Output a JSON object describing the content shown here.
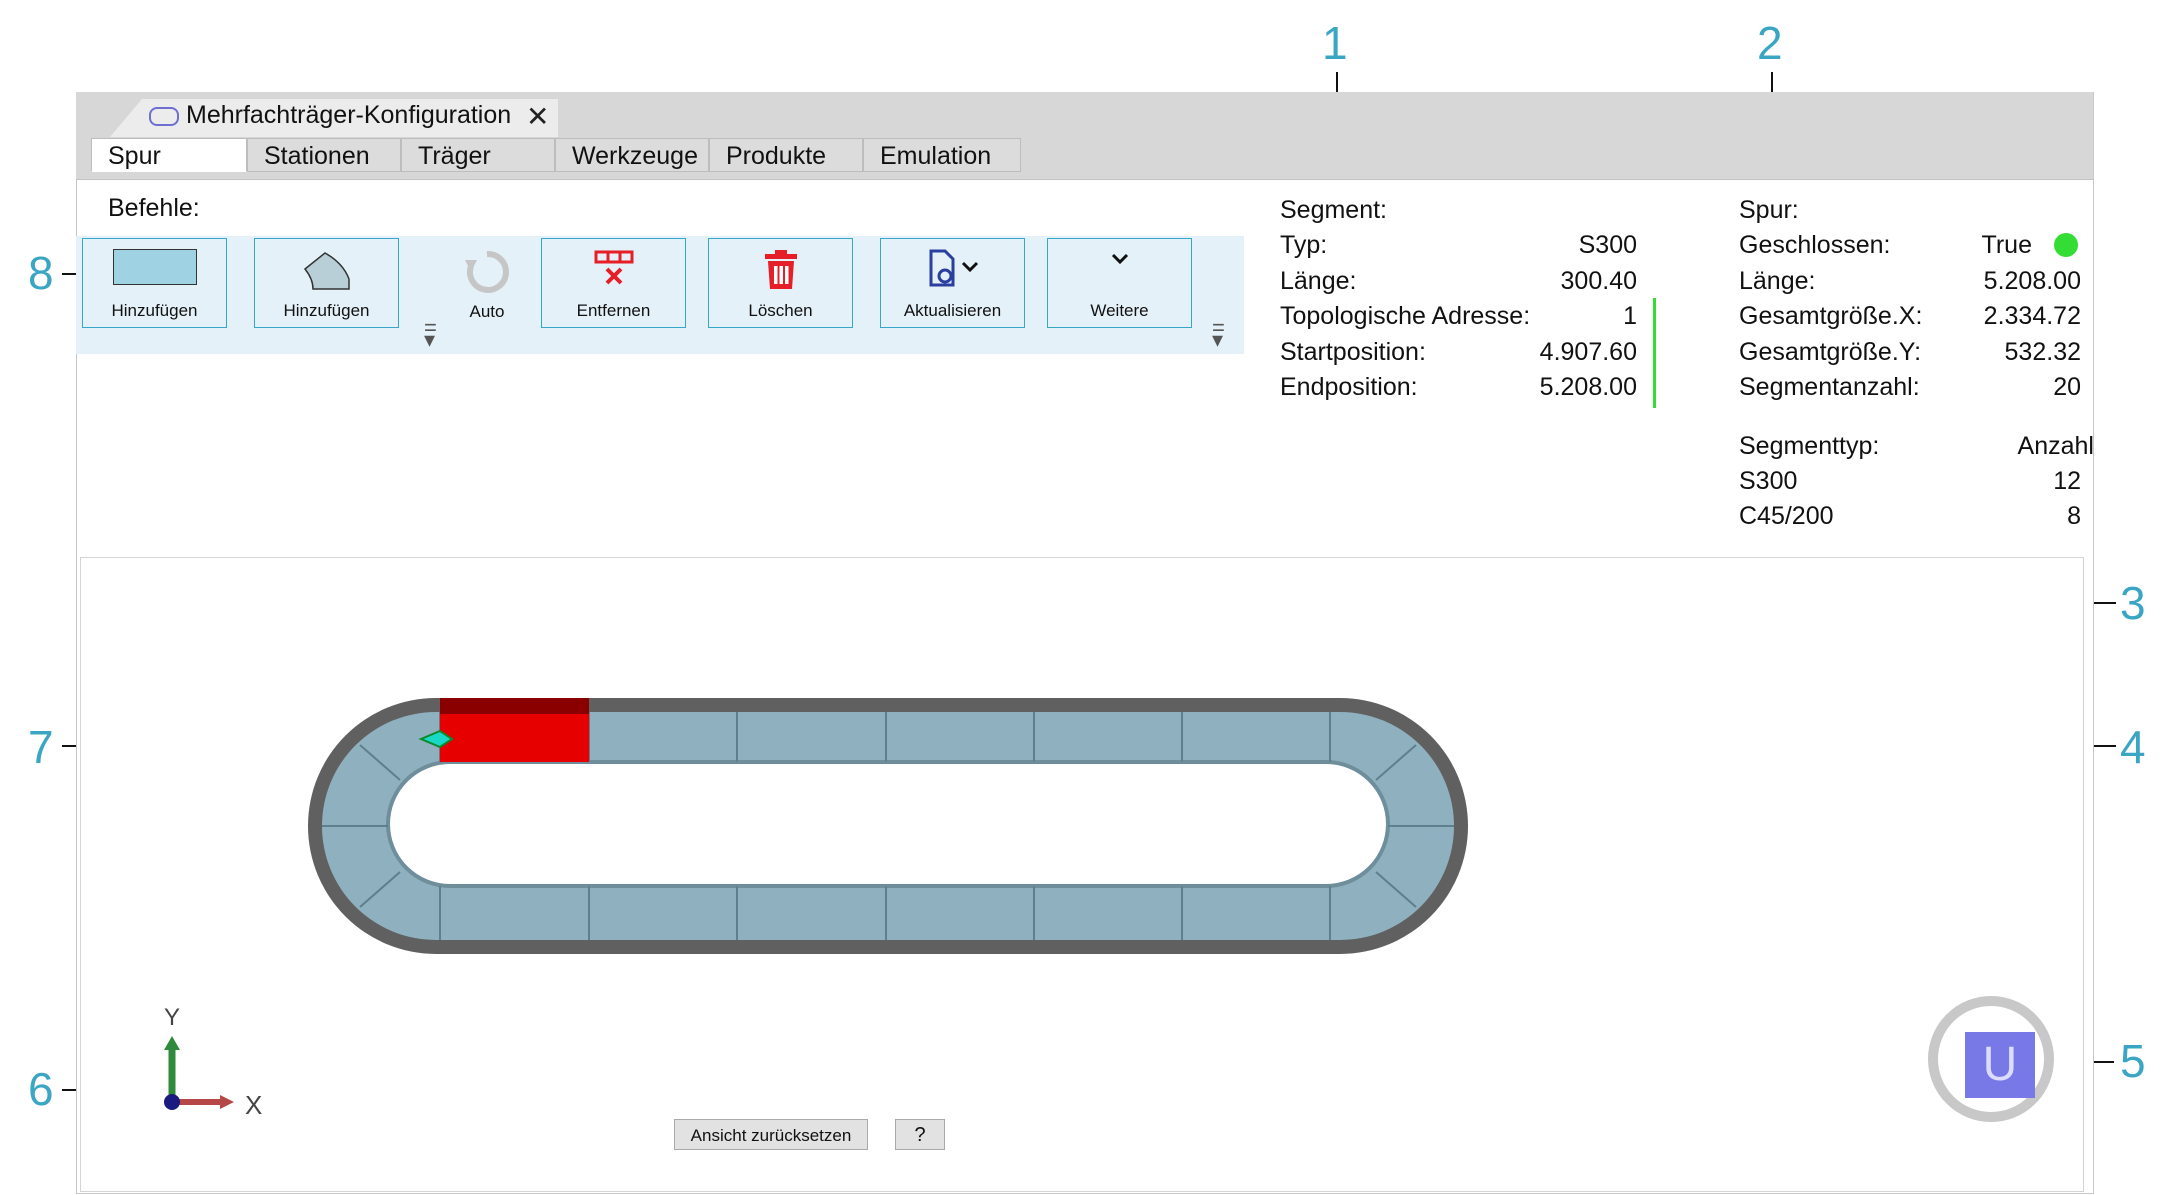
{
  "window": {
    "doc_tab_title": "Mehrfachträger-Konfiguration",
    "doc_tab_close": "✕"
  },
  "tabs": [
    {
      "label": "Spur"
    },
    {
      "label": "Stationen"
    },
    {
      "label": "Träger"
    },
    {
      "label": "Werkzeuge"
    },
    {
      "label": "Produkte"
    },
    {
      "label": "Emulation"
    }
  ],
  "commands": {
    "heading": "Befehle:",
    "items": [
      {
        "label": "Hinzufügen",
        "icon": "straight-segment-icon"
      },
      {
        "label": "Hinzufügen",
        "icon": "curve-segment-icon"
      },
      {
        "label": "Auto",
        "icon": "auto-refresh-icon"
      },
      {
        "label": "Entfernen",
        "icon": "remove-segment-icon"
      },
      {
        "label": "Löschen",
        "icon": "trash-icon"
      },
      {
        "label": "Aktualisieren",
        "icon": "update-document-icon"
      },
      {
        "label": "Weitere",
        "icon": "chevron-down-icon"
      }
    ]
  },
  "segment": {
    "heading": "Segment:",
    "rows": [
      {
        "label": "Typ:",
        "value": "S300"
      },
      {
        "label": "Länge:",
        "value": "300.40"
      },
      {
        "label": "Topologische Adresse:",
        "value": "1"
      },
      {
        "label": "Startposition:",
        "value": "4.907.60"
      },
      {
        "label": "Endposition:",
        "value": "5.208.00"
      }
    ]
  },
  "track": {
    "heading": "Spur:",
    "rows": [
      {
        "label": "Geschlossen:",
        "value": "True"
      },
      {
        "label": "Länge:",
        "value": "5.208.00"
      },
      {
        "label": "Gesamtgröße.X:",
        "value": "2.334.72"
      },
      {
        "label": "Gesamtgröße.Y:",
        "value": "532.32"
      },
      {
        "label": "Segmentanzahl:",
        "value": "20"
      }
    ],
    "closed_status_color": "#33dd33",
    "segment_types_header": {
      "label": "Segmenttyp:",
      "value": "Anzahl"
    },
    "segment_types": [
      {
        "label": "S300",
        "value": "12"
      },
      {
        "label": "C45/200",
        "value": "8"
      }
    ]
  },
  "viewport": {
    "reset_view_label": "Ansicht zurücksetzen",
    "help_label": "?",
    "axis_x_label": "X",
    "axis_y_label": "Y",
    "view_cube_label": "U",
    "selected_segment_color": "#e60000",
    "segment_color": "#8fb0bf",
    "rail_color": "#606060"
  },
  "callouts": [
    "1",
    "2",
    "3",
    "4",
    "5",
    "6",
    "7",
    "8"
  ]
}
